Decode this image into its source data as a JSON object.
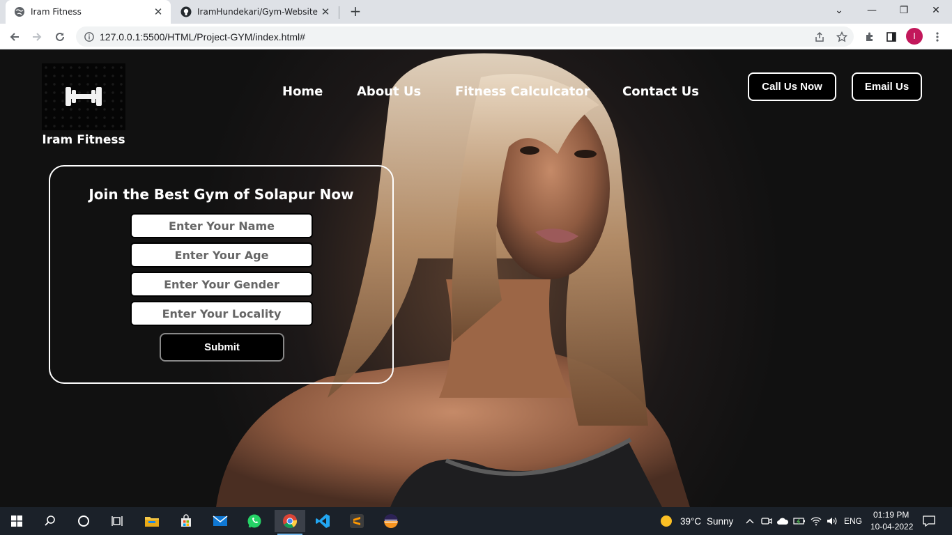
{
  "browser": {
    "tabs": [
      {
        "title": "Iram Fitness",
        "icon": "globe-icon",
        "active": true
      },
      {
        "title": "IramHundekari/Gym-Website at ...",
        "icon": "github-icon",
        "active": false
      }
    ],
    "new_tab": "+",
    "url": "127.0.0.1:5500/HTML/Project-GYM/index.html#",
    "profile_initial": "I",
    "profile_color": "#c2185b"
  },
  "site": {
    "brand": "Iram Fitness",
    "logo_icon": "dumbbell-icon",
    "nav": [
      "Home",
      "About Us",
      "Fitness Calculcator",
      "Contact Us"
    ],
    "cta": [
      "Call Us Now",
      "Email Us"
    ],
    "form": {
      "title": "Join the Best Gym of Solapur Now",
      "placeholders": [
        "Enter Your Name",
        "Enter Your Age",
        "Enter Your Gender",
        "Enter Your Locality"
      ],
      "submit": "Submit"
    }
  },
  "taskbar": {
    "apps": [
      "windows-start-icon",
      "search-icon",
      "cortana-icon",
      "task-view-icon",
      "file-explorer-icon",
      "microsoft-store-icon",
      "mail-icon",
      "whatsapp-icon",
      "chrome-icon",
      "vscode-icon",
      "sublime-text-icon",
      "eclipse-icon"
    ],
    "weather": {
      "temp": "39°C",
      "condition": "Sunny"
    },
    "language": "ENG",
    "time": "01:19 PM",
    "date": "10-04-2022"
  }
}
